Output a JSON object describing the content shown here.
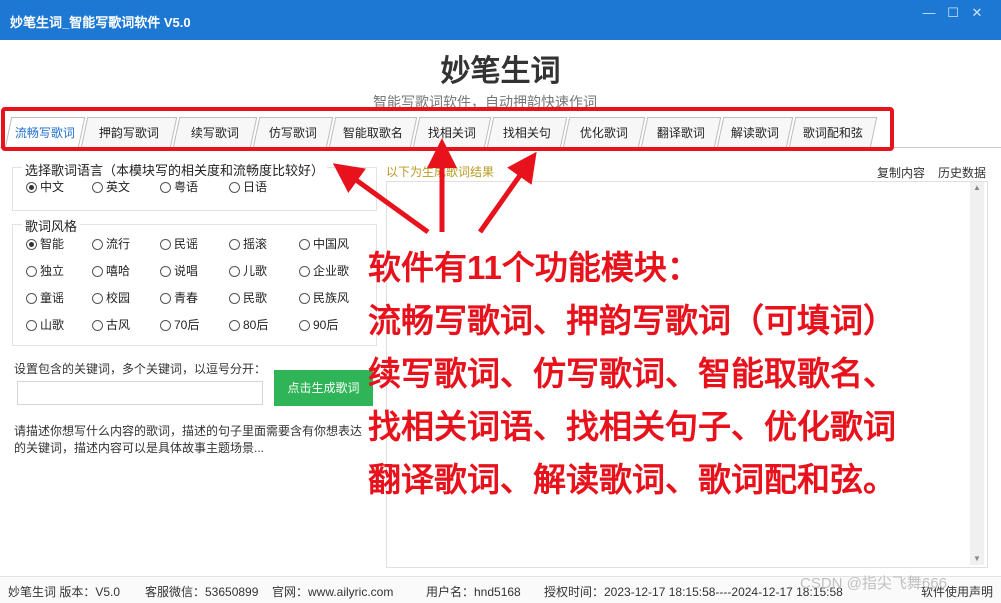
{
  "window": {
    "title": "妙笔生词_智能写歌词软件 V5.0"
  },
  "header": {
    "title": "妙笔生词",
    "subtitle": "智能写歌词软件，自动押韵快速作词"
  },
  "tabs": [
    {
      "label": "流畅写歌词",
      "active": true
    },
    {
      "label": "押韵写歌词"
    },
    {
      "label": "续写歌词"
    },
    {
      "label": "仿写歌词"
    },
    {
      "label": "智能取歌名"
    },
    {
      "label": "找相关词"
    },
    {
      "label": "找相关句"
    },
    {
      "label": "优化歌词"
    },
    {
      "label": "翻译歌词"
    },
    {
      "label": "解读歌词"
    },
    {
      "label": "歌词配和弦"
    }
  ],
  "language": {
    "title": "选择歌词语言（本模块写的相关度和流畅度比较好）",
    "options": [
      "中文",
      "英文",
      "粤语",
      "日语"
    ],
    "selected": "中文"
  },
  "style": {
    "title": "歌词风格",
    "options": [
      "智能",
      "流行",
      "民谣",
      "摇滚",
      "中国风",
      "独立",
      "嘻哈",
      "说唱",
      "儿歌",
      "企业歌",
      "童谣",
      "校园",
      "青春",
      "民歌",
      "民族风",
      "山歌",
      "古风",
      "70后",
      "80后",
      "90后"
    ],
    "selected": "智能"
  },
  "keywords": {
    "label": "设置包含的关键词，多个关键词，以逗号分开：",
    "value": "",
    "generate_button": "点击生成歌词"
  },
  "description": "请描述你想写什么内容的歌词，描述的句子里面需要含有你想表达的关键词，描述内容可以是具体故事主题场景...",
  "result": {
    "label": "以下为生成歌词结果",
    "copy": "复制内容",
    "history": "历史数据"
  },
  "status": {
    "app": "妙笔生词 版本：V5.0",
    "support": "客服微信：53650899",
    "website": "官网：www.ailyric.com",
    "user": "用户名：hnd5168",
    "license": "授权时间：2023-12-17 18:15:58----2024-12-17 18:15:58",
    "disclaimer": "软件使用声明"
  },
  "annotation": {
    "lines": [
      "软件有11个功能模块：",
      "流畅写歌词、押韵写歌词（可填词）",
      "续写歌词、仿写歌词、智能取歌名、",
      "找相关词语、找相关句子、优化歌词",
      "翻译歌词、解读歌词、歌词配和弦。"
    ],
    "color": "#e8121c"
  },
  "watermark": "CSDN @指尖飞舞666",
  "colors": {
    "titlebar": "#1d78d3",
    "generate_button": "#2fb457",
    "annotation": "#e8121c"
  }
}
